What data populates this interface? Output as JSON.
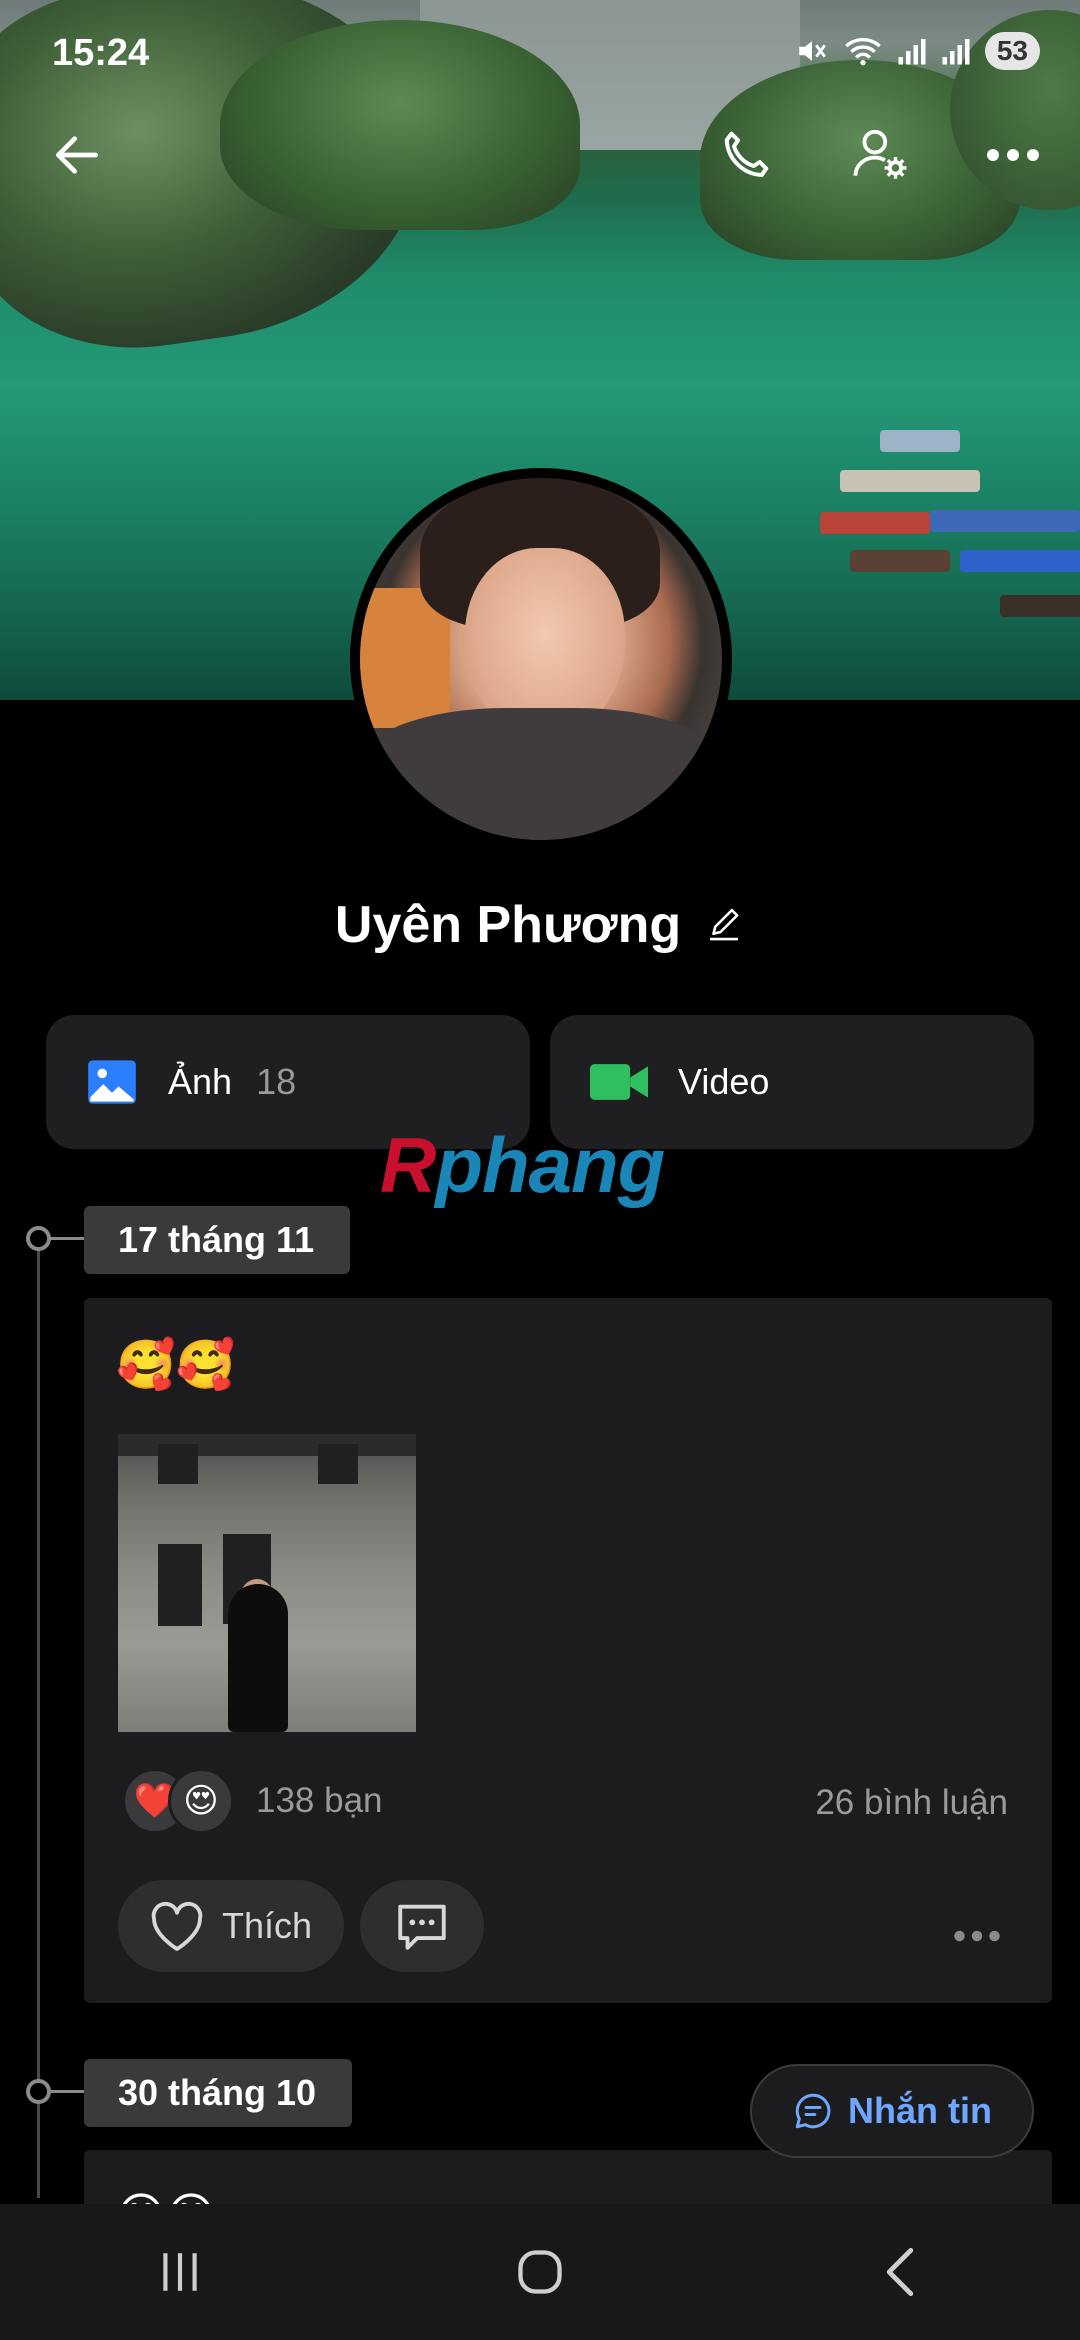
{
  "status_bar": {
    "time": "15:24",
    "battery": "53",
    "icons": [
      "mute-icon",
      "wifi-icon",
      "signal-icon",
      "signal-icon"
    ]
  },
  "top_bar": {
    "back_icon": "back-arrow-icon",
    "call_icon": "phone-icon",
    "settings_icon": "user-settings-icon",
    "more_icon": "more-icon"
  },
  "profile": {
    "name": "Uyên Phương",
    "edit_icon": "pencil-icon"
  },
  "media": {
    "photos_label": "Ảnh",
    "photos_count": "18",
    "video_label": "Video",
    "photo_icon_color": "#2b7fff",
    "video_icon_color": "#2fbf5e"
  },
  "watermark": {
    "first": "R",
    "rest": "phang"
  },
  "timeline": [
    {
      "date": "17 tháng 11",
      "text": "🥰🥰",
      "reactions": [
        "❤️",
        "😍"
      ],
      "reaction_count": "138 bạn",
      "comment_count": "26 bình luận",
      "like_label": "Thích"
    },
    {
      "date": "30 tháng 10",
      "text": "😊😊"
    }
  ],
  "message_button": {
    "label": "Nhắn tin"
  },
  "colors": {
    "background": "#000000",
    "card": "#1c1c1e",
    "accent": "#6ea7ff"
  }
}
